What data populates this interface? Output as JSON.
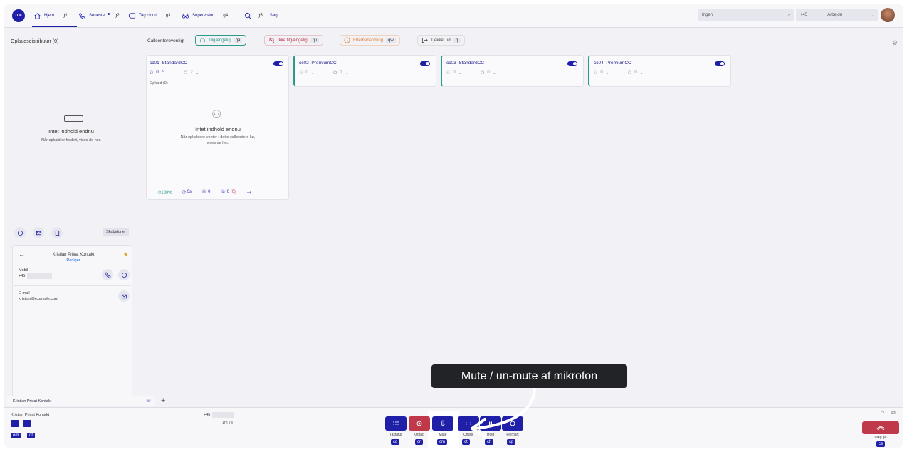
{
  "nav": {
    "logo": "TOC",
    "items": [
      {
        "label": "Hjem",
        "key": "g1",
        "icon": "home-icon"
      },
      {
        "label": "Seneste",
        "key": "g2",
        "icon": "phone-icon"
      },
      {
        "label": "Tag cloud",
        "key": "g3",
        "icon": "tag-icon"
      },
      {
        "label": "Supervision",
        "key": "g4",
        "icon": "glasses-icon"
      },
      {
        "label": "Søg",
        "key": "g5",
        "icon": "search-icon"
      }
    ],
    "status_select": "Ingen",
    "phone_prefix": "+45",
    "profile_select": "Arbejde"
  },
  "left_panel": {
    "title": "Opkaldsdistributør (0)",
    "empty_title": "Intet indhold endnu",
    "empty_text": "Når opkald er fordelt, vises de her."
  },
  "overview": {
    "label": "Callcenteroversigt",
    "filters": [
      {
        "label": "Tilgængelig",
        "key": "qa",
        "color": "#2a9a8a"
      },
      {
        "label": "Ikke tilgængelig",
        "key": "qu",
        "color": "#c0394a"
      },
      {
        "label": "Efterbehandling",
        "key": "qw",
        "color": "#e0803a"
      },
      {
        "label": "Tjekket ud",
        "key": "ql",
        "color": "#444"
      }
    ],
    "callcenters": [
      {
        "name": "cc01_StandardCC",
        "agents": "0",
        "queue": "2"
      },
      {
        "name": "cc02_PremiumCC",
        "agents": "0",
        "queue": "1"
      },
      {
        "name": "cc03_StandardCC",
        "agents": "0",
        "queue": "0"
      },
      {
        "name": "cc04_PremiumCC",
        "agents": "0",
        "queue": "0"
      }
    ],
    "calls_label": "Opkald (0)",
    "empty_title": "Intet indhold endnu",
    "empty_text": "Når opkaldere venter i dette callcenters kø, vises de her.",
    "stats": {
      "sla": "100%",
      "wait": "0s",
      "answered": "0",
      "lost": "0",
      "lost_extra": "(0)"
    }
  },
  "contact": {
    "templates_label": "Skabeloner",
    "name": "Kristian Privat Kontakt",
    "edit_label": "Rediger",
    "mobile_label": "Mobil",
    "mobile_value": "+45",
    "email_label": "E-mail",
    "email_value": "kristian@example.com",
    "tab_label": "Kristian Privat Kontakt"
  },
  "callbar": {
    "contact_name": "Kristian Privat Kontakt",
    "number": "+45",
    "duration": "1m 7s",
    "left_keys": [
      "om",
      "ot"
    ],
    "buttons": [
      {
        "label": "Tastatur",
        "key": "cd"
      },
      {
        "label": "Optag",
        "key": "cr"
      },
      {
        "label": "Mute",
        "key": "cm"
      },
      {
        "label": "Omstil",
        "key": "ct"
      },
      {
        "label": "Hold",
        "key": "ch"
      },
      {
        "label": "Flerpart",
        "key": "cp"
      }
    ],
    "hangup_label": "Læg på",
    "hangup_key": "ce"
  },
  "tooltip": "Mute / un-mute af mikrofon"
}
